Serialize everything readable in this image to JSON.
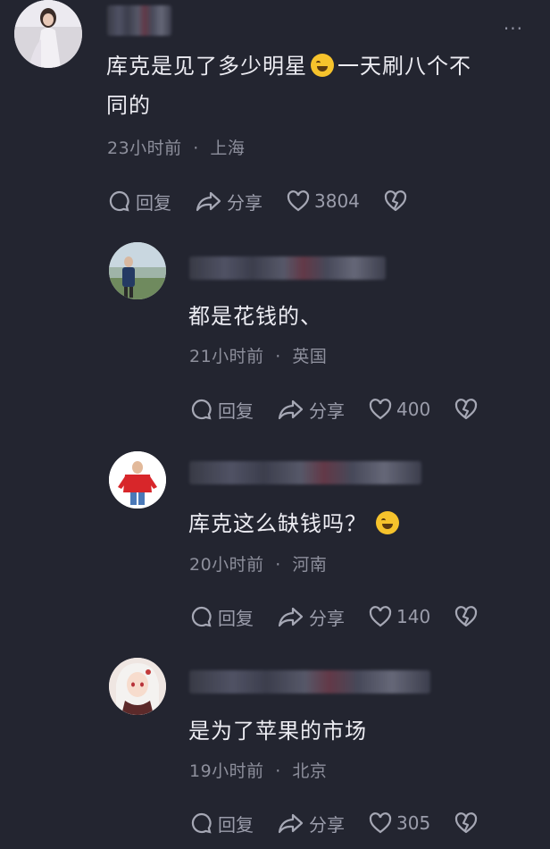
{
  "comments": [
    {
      "text_line1": "库克是见了多少明星",
      "text_line1b": "一天刷八个不",
      "text_line2": "同的",
      "time": "23小时前",
      "location": "上海",
      "reply_label": "回复",
      "share_label": "分享",
      "likes": "3804"
    },
    {
      "text": "都是花钱的、",
      "time": "21小时前",
      "location": "英国",
      "reply_label": "回复",
      "share_label": "分享",
      "likes": "400"
    },
    {
      "text": "库克这么缺钱吗？",
      "time": "20小时前",
      "location": "河南",
      "reply_label": "回复",
      "share_label": "分享",
      "likes": "140"
    },
    {
      "text": "是为了苹果的市场",
      "time": "19小时前",
      "location": "北京",
      "reply_label": "回复",
      "share_label": "分享",
      "likes": "305"
    }
  ],
  "separator": "·",
  "more_label": "···",
  "icons": {
    "reply": "comment-bubble-icon",
    "share": "share-arrow-icon",
    "like": "heart-icon",
    "dislike": "broken-heart-icon",
    "emoji": "laughing-tears-emoji-icon"
  },
  "colors": {
    "background": "#232530",
    "text": "#ececf2",
    "meta": "#8d8f9c"
  }
}
